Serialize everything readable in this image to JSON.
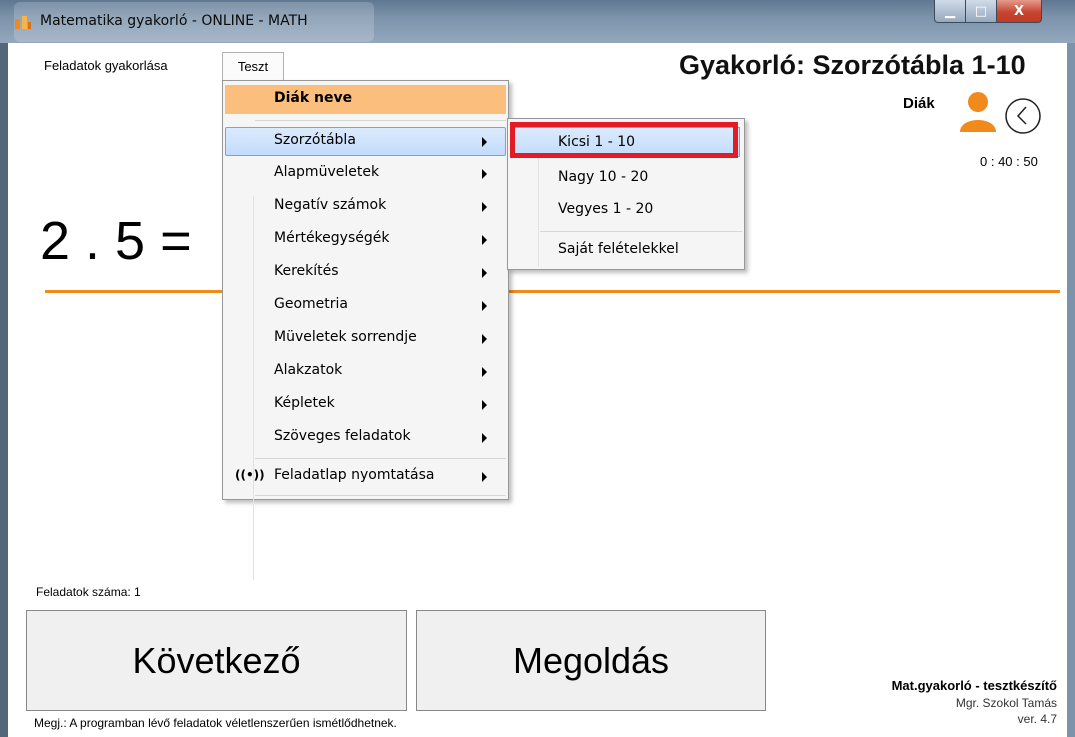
{
  "window": {
    "title": "Matematika gyakorló - ONLINE - MATH",
    "controls": {
      "minimize": "▁",
      "maximize": "□",
      "close": "X"
    }
  },
  "menubar": {
    "items": [
      "Feladatok gyakorlása",
      "Teszt"
    ]
  },
  "header": {
    "title": "Gyakorló: Szorzótábla 1-10",
    "student_label": "Diák",
    "timer": "0 : 40 : 50",
    "icons": [
      "user-icon",
      "clock-icon"
    ]
  },
  "equation": "2 . 5 =",
  "dropdown": {
    "header_item": "Diák neve",
    "items": [
      "Szorzótábla",
      "Alapmüveletek",
      "Negatív számok",
      "Mértékegységék",
      "Kerekítés",
      "Geometria",
      "Müveletek sorrendje",
      "Alakzatok",
      "Képletek",
      "Szöveges feladatok"
    ],
    "print_item": "Feladatlap nyomtatása",
    "print_icon": "((•))"
  },
  "submenu": {
    "items": [
      "Kicsi 1 - 10",
      "Nagy 10 - 20",
      "Vegyes 1 - 20"
    ],
    "custom_item": "Saját felételekkel"
  },
  "bottom": {
    "task_count": "Feladatok száma: 1",
    "next_button": "Következő",
    "solution_button": "Megoldás",
    "credit_title": "Mat.gyakorló - tesztkészítő",
    "credit_author": "Mgr. Szokol Tamás",
    "version": "ver. 4.7",
    "footer_note": "Megj.: A programban lévő feladatok véletlenszerűen ismétlődhetnek."
  },
  "colors": {
    "accent_orange": "#f08a1c",
    "menu_highlight": "#fcbe7d",
    "selection_red": "#e21b24"
  }
}
